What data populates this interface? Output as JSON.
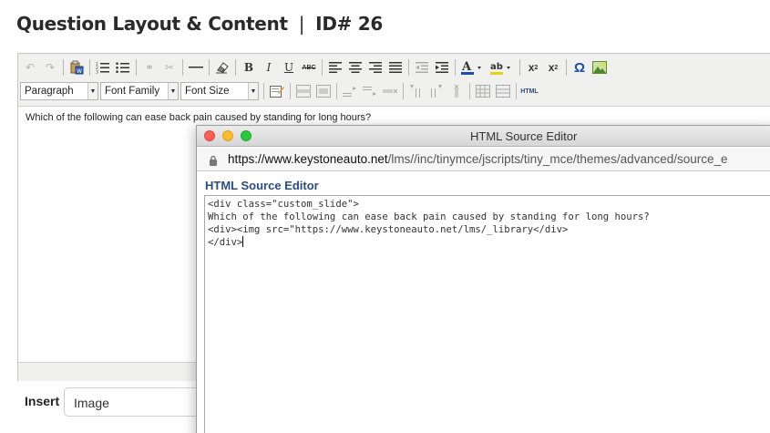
{
  "page": {
    "title": "Question Layout & Content",
    "separator": "|",
    "id_label": "ID# 26"
  },
  "editor": {
    "toolbar1": [
      {
        "name": "undo-icon",
        "glyph": "↶"
      },
      {
        "name": "redo-icon",
        "glyph": "↷"
      },
      {
        "name": "paste-word-icon",
        "glyph": "W"
      },
      {
        "name": "numbered-list-icon"
      },
      {
        "name": "bullet-list-icon"
      },
      {
        "name": "link-icon",
        "glyph": "⚭"
      },
      {
        "name": "unlink-icon",
        "glyph": "✂"
      },
      {
        "name": "horizontal-rule-icon"
      },
      {
        "name": "eraser-icon",
        "glyph": "⌫"
      },
      {
        "name": "bold-icon",
        "glyph": "B"
      },
      {
        "name": "italic-icon",
        "glyph": "I"
      },
      {
        "name": "underline-icon",
        "glyph": "U"
      },
      {
        "name": "strikethrough-icon",
        "glyph": "ABC"
      },
      {
        "name": "align-left-icon"
      },
      {
        "name": "align-center-icon"
      },
      {
        "name": "align-right-icon"
      },
      {
        "name": "align-justify-icon"
      },
      {
        "name": "outdent-icon"
      },
      {
        "name": "indent-icon"
      },
      {
        "name": "text-color-icon",
        "glyph": "A"
      },
      {
        "name": "highlight-color-icon",
        "glyph": "ab"
      },
      {
        "name": "subscript-icon",
        "glyph": "x₂"
      },
      {
        "name": "superscript-icon",
        "glyph": "x²"
      },
      {
        "name": "omega-icon",
        "glyph": "Ω"
      },
      {
        "name": "image-icon"
      }
    ],
    "format_select": "Paragraph",
    "font_family_select": "Font Family",
    "font_size_select": "Font Size",
    "html_button_label": "HTML",
    "content": "Which of the following can ease back pain caused by standing for long hours?"
  },
  "insert": {
    "label": "Insert",
    "selected": "Image"
  },
  "popup": {
    "window_title": "HTML Source Editor",
    "url_host": "https://www.keystoneauto.net",
    "url_path": "/lms//inc/tinymce/jscripts/tiny_mce/themes/advanced/source_e",
    "pane_title": "HTML Source Editor",
    "source_lines": [
      "<div class=\"custom_slide\">",
      "Which of the following can ease back pain caused by standing for long hours?",
      "<div><img src=\"https://www.keystoneauto.net/lms/_library</div>",
      "</div>"
    ]
  },
  "colors": {
    "title_blue": "#2b4e7b",
    "close": "#fc5f57",
    "minimize": "#fdbb2e",
    "maximize": "#29c840"
  }
}
